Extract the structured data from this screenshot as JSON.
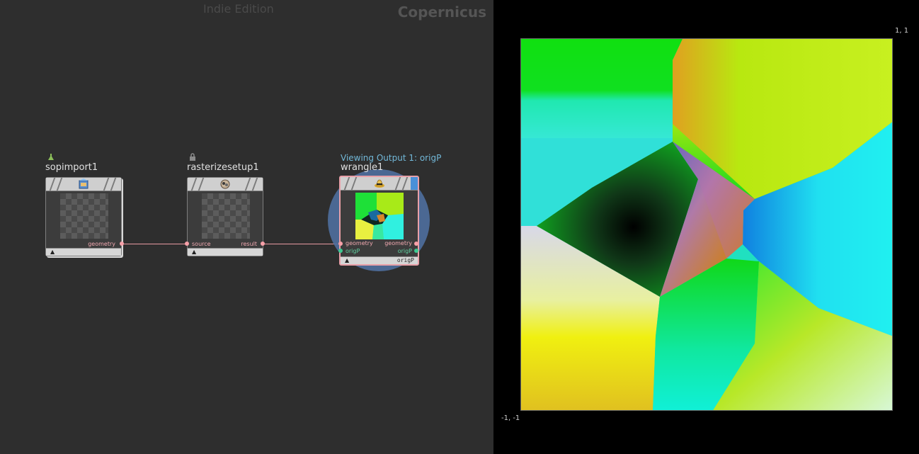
{
  "network": {
    "edition": "Indie Edition",
    "context": "Copernicus",
    "nodes": [
      {
        "name": "sopimport1",
        "icon": "sop-import-icon",
        "outputs": [
          "geometry"
        ]
      },
      {
        "name": "rasterizesetup1",
        "icon": "rasterize-setup-icon",
        "inputs": [
          "source"
        ],
        "outputs": [
          "result"
        ]
      },
      {
        "name": "wrangle1",
        "icon": "wrangle-icon",
        "viewing_label": "Viewing Output 1: origP",
        "inputs": [
          "geometry",
          "origP"
        ],
        "outputs": [
          "geometry",
          "origP"
        ],
        "footer_label": "origP"
      }
    ],
    "footer_arrow": "▲"
  },
  "viewer": {
    "coord_top_right": "1, 1",
    "coord_bottom_left": "-1, -1"
  },
  "colors": {
    "wire": "#e89aa2",
    "view_ring": "#4f6f9f",
    "viewing_label": "#72b8d8"
  }
}
